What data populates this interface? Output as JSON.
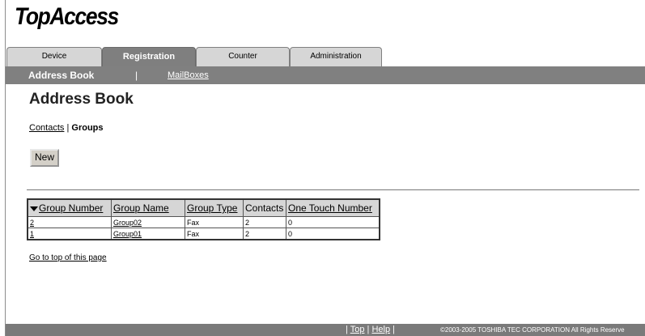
{
  "app": {
    "logo": "TopAccess"
  },
  "tabs": [
    {
      "label": "Device",
      "active": false
    },
    {
      "label": "Registration",
      "active": true
    },
    {
      "label": "Counter",
      "active": false
    },
    {
      "label": "Administration",
      "active": false
    }
  ],
  "subnav": {
    "current": "Address Book",
    "separator": "|",
    "mailboxes": "MailBoxes"
  },
  "page": {
    "title": "Address Book"
  },
  "crumbs": {
    "contacts": "Contacts",
    "separator": " | ",
    "groups": "Groups"
  },
  "actions": {
    "new_label": "New"
  },
  "table": {
    "headers": [
      "Group Number",
      "Group Name",
      "Group Type",
      "Contacts",
      "One Touch Number"
    ],
    "sort_column": "Group Number",
    "rows": [
      {
        "number": "2",
        "name": "Group02",
        "type": "Fax",
        "contacts": "2",
        "one_touch": "0"
      },
      {
        "number": "1",
        "name": "Group01",
        "type": "Fax",
        "contacts": "2",
        "one_touch": "0"
      }
    ]
  },
  "links": {
    "go_top": "Go to top of this page"
  },
  "footer": {
    "lead_sep": "|",
    "top": "Top",
    "mid_sep": "|",
    "help": "Help",
    "trail_sep": "|",
    "copyright": "©2003-2005 TOSHIBA TEC CORPORATION All Rights Reserve"
  },
  "colors": {
    "tab_active": "#7f7f7f",
    "tab_inactive": "#d6d6d6",
    "subnav_bg": "#808080",
    "footer_bg": "#7a7a7a"
  }
}
